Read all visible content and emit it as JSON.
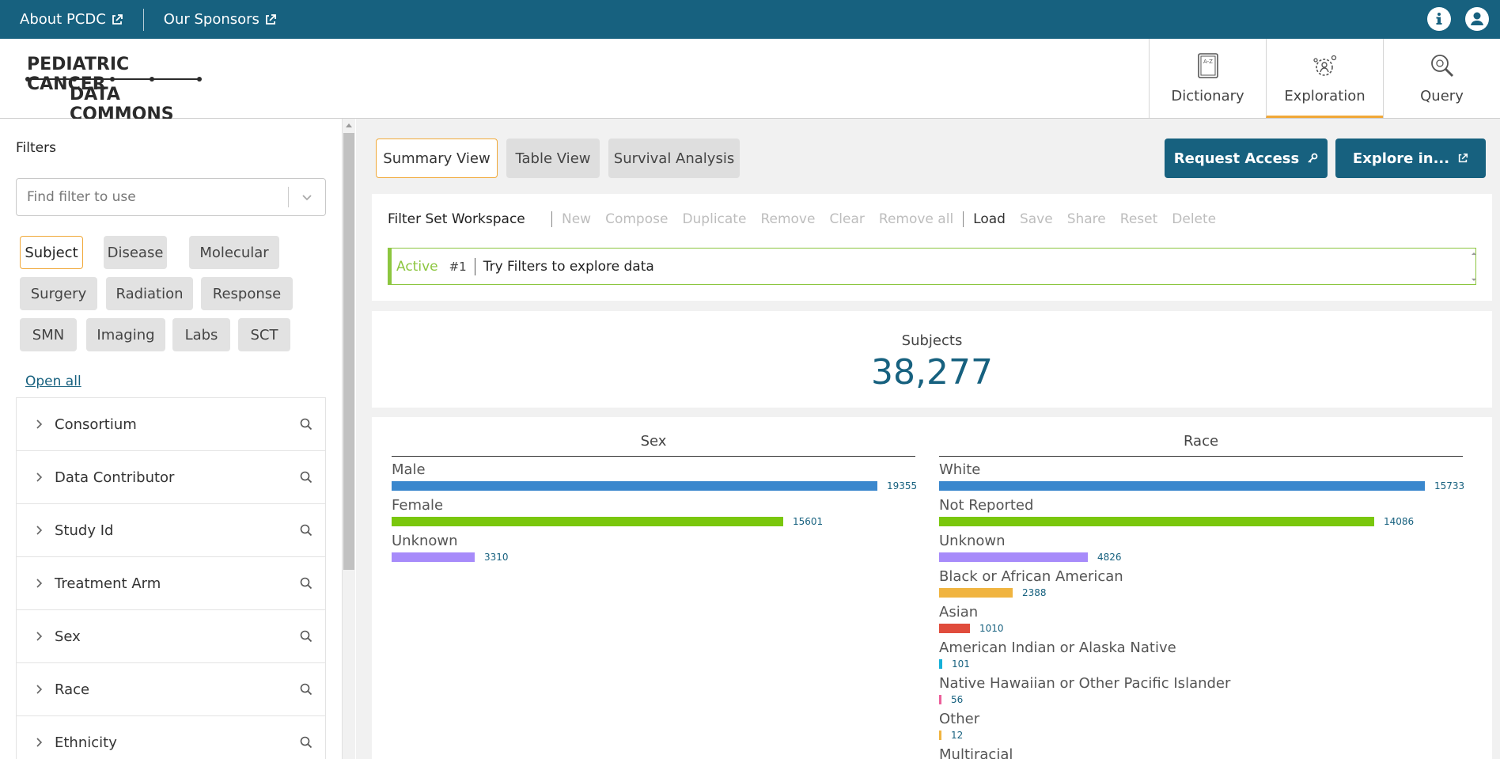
{
  "topbar": {
    "links": [
      "About PCDC",
      "Our Sponsors"
    ]
  },
  "logo": {
    "line1": "PEDIATRIC CANCER",
    "line2": "DATA COMMONS"
  },
  "nav": {
    "tabs": [
      "Dictionary",
      "Exploration",
      "Query"
    ],
    "active": "Exploration"
  },
  "sidebar": {
    "title": "Filters",
    "search_placeholder": "Find filter to use",
    "chips": [
      "Subject",
      "Disease",
      "Molecular",
      "Surgery",
      "Radiation",
      "Response",
      "SMN",
      "Imaging",
      "Labs",
      "SCT"
    ],
    "open_all": "Open all",
    "facets": [
      "Consortium",
      "Data Contributor",
      "Study Id",
      "Treatment Arm",
      "Sex",
      "Race",
      "Ethnicity"
    ]
  },
  "main": {
    "view_tabs": [
      "Summary View",
      "Table View",
      "Survival Analysis"
    ],
    "request_access": "Request Access",
    "explore_in": "Explore in...",
    "workspace": {
      "title": "Filter Set Workspace",
      "actions": [
        "New",
        "Compose",
        "Duplicate",
        "Remove",
        "Clear",
        "Remove all",
        "Load",
        "Save",
        "Share",
        "Reset",
        "Delete"
      ],
      "status": "Active",
      "number": "#1",
      "message": "Try Filters to explore data"
    },
    "summary": {
      "label": "Subjects",
      "value": "38,277"
    }
  },
  "colors": {
    "accent": "#17617f",
    "highlight": "#f0a838",
    "active_green": "#8cc63f"
  },
  "chart_data": [
    {
      "type": "bar",
      "title": "Sex",
      "categories": [
        "Male",
        "Female",
        "Unknown"
      ],
      "values": [
        19355,
        15601,
        3310
      ],
      "colors": [
        "#3a87cd",
        "#7ac70c",
        "#a78bfa"
      ]
    },
    {
      "type": "bar",
      "title": "Race",
      "categories": [
        "White",
        "Not Reported",
        "Unknown",
        "Black or African American",
        "Asian",
        "American Indian or Alaska Native",
        "Native Hawaiian or Other Pacific Islander",
        "Other",
        "Multiracial"
      ],
      "values": [
        15733,
        14086,
        4826,
        2388,
        1010,
        101,
        56,
        12,
        null
      ],
      "colors": [
        "#3a87cd",
        "#7ac70c",
        "#a78bfa",
        "#f0b440",
        "#e04c3c",
        "#16b0d8",
        "#ec5f9a",
        "#f0b440",
        "#3a87cd"
      ]
    }
  ]
}
